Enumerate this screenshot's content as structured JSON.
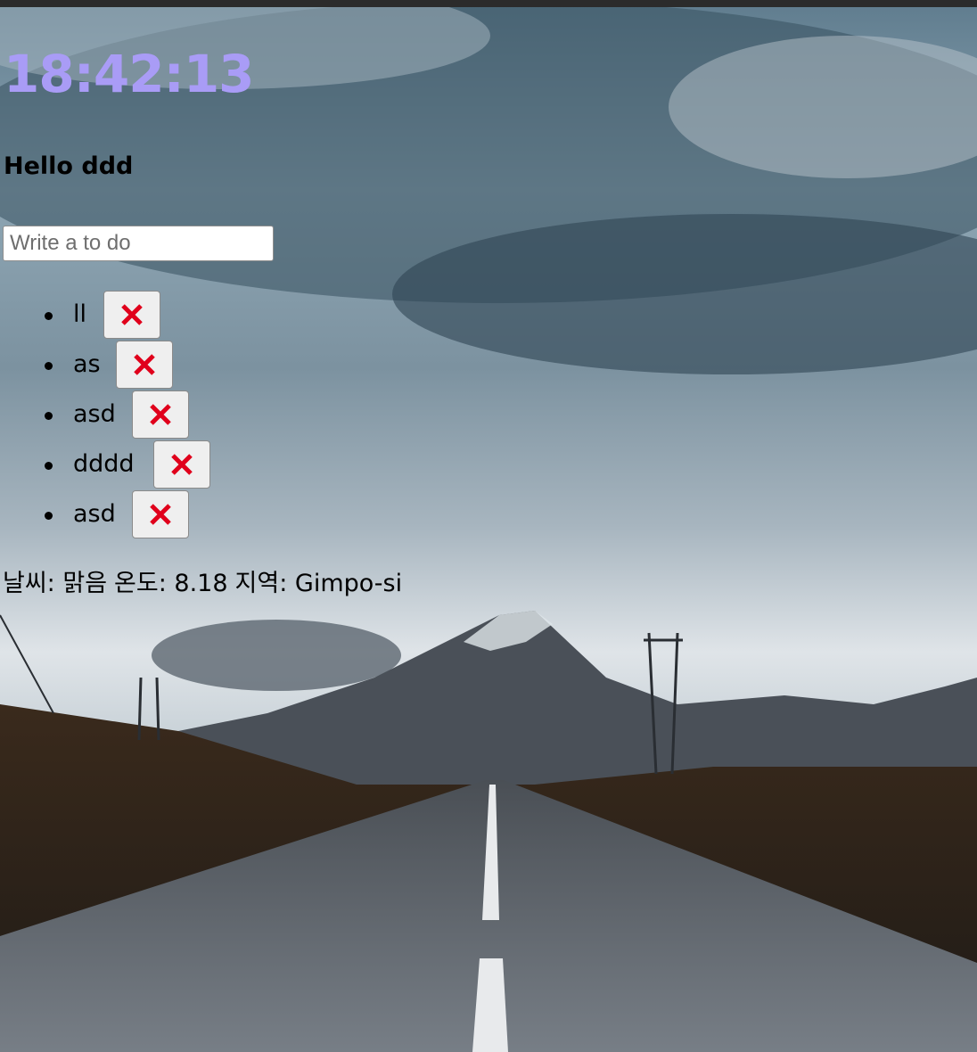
{
  "clock": {
    "time": "18:42:13",
    "color": "#a99cf6"
  },
  "greeting": {
    "text": "Hello ddd"
  },
  "todo_form": {
    "placeholder": "Write a to do",
    "value": ""
  },
  "todos": [
    {
      "text": "ll",
      "delete_icon": "red-x-icon"
    },
    {
      "text": "as",
      "delete_icon": "red-x-icon"
    },
    {
      "text": "asd",
      "delete_icon": "red-x-icon"
    },
    {
      "text": "dddd",
      "delete_icon": "red-x-icon"
    },
    {
      "text": "asd",
      "delete_icon": "red-x-icon"
    }
  ],
  "weather": {
    "condition": "날씨: 맑음",
    "temperature": "온도: 8.18",
    "location": "지역: Gimpo-si"
  },
  "colors": {
    "delete_x": "#e0001b",
    "button_bg": "#efefef"
  }
}
